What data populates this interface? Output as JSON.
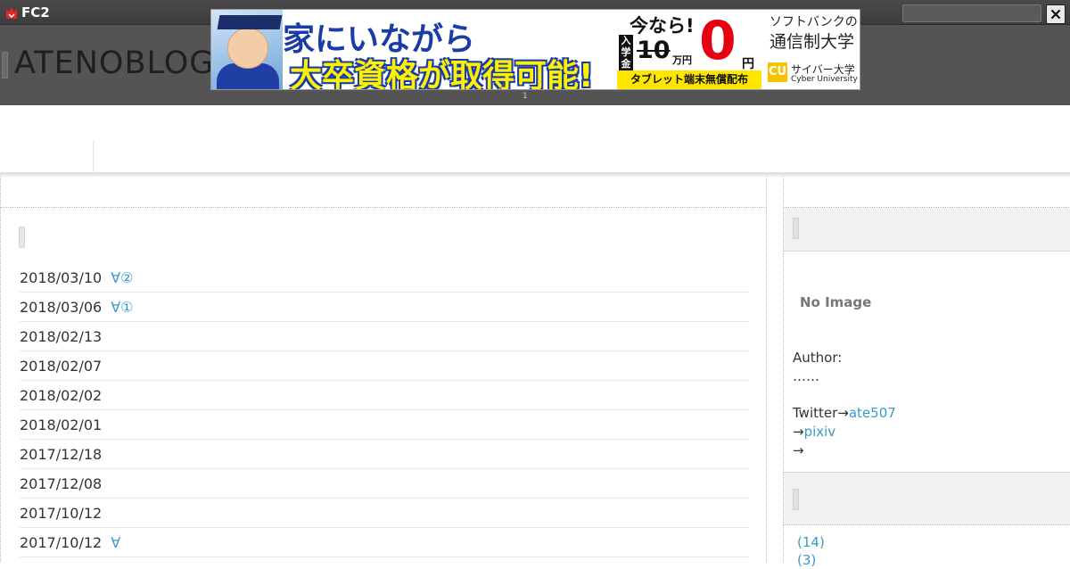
{
  "fc2bar": {
    "logo_text": "FC2",
    "search_placeholder": "",
    "close_label": "✕"
  },
  "header": {
    "blog_title": "ATENOBLOG"
  },
  "ad": {
    "headline_1": "家にいながら",
    "headline_2": "大卒資格が取得可能!",
    "now_text": "今なら!",
    "entry_fee_label": "入学金",
    "old_price": "10",
    "old_price_unit": "万円",
    "new_price": "0",
    "new_price_unit": "円",
    "tablet_text": "タブレット端末無償配布",
    "sponsor_line_1": "ソフトバンクの",
    "sponsor_line_2": "通信制大学",
    "logo_mark": "CU",
    "university_name": "サイバー大学",
    "university_name_en": "Cyber University",
    "index": "1"
  },
  "entries": [
    {
      "date": "2018/03/10",
      "title": "∀②"
    },
    {
      "date": "2018/03/06",
      "title": "∀①"
    },
    {
      "date": "2018/02/13",
      "title": ""
    },
    {
      "date": "2018/02/07",
      "title": ""
    },
    {
      "date": "2018/02/02",
      "title": ""
    },
    {
      "date": "2018/02/01",
      "title": ""
    },
    {
      "date": "2017/12/18",
      "title": ""
    },
    {
      "date": "2017/12/08",
      "title": ""
    },
    {
      "date": "2017/10/12",
      "title": ""
    },
    {
      "date": "2017/10/12",
      "title": "∀"
    }
  ],
  "sidebar": {
    "no_image": "No Image",
    "author_label": "Author:",
    "author_name": "……",
    "twitter_label": "Twitter→",
    "twitter_handle": "ate507",
    "pixiv_prefix": "→",
    "pixiv_link": "pixiv",
    "extra_arrow": "→",
    "categories": [
      "(14)",
      "(3)"
    ]
  },
  "colors": {
    "link": "#3a9ac9",
    "header_bg": "#545454",
    "topbar_bg": "#3c3c3c"
  }
}
